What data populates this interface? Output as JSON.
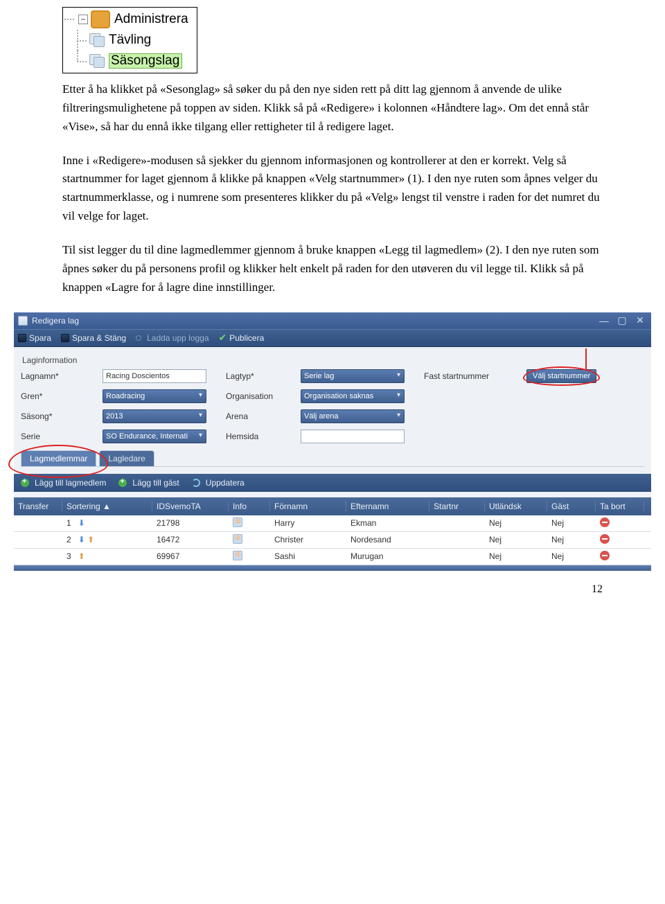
{
  "tree": {
    "root": "Administrera",
    "child1": "Tävling",
    "child2": "Säsongslag"
  },
  "para1": "Etter å ha klikket på «Sesonglag» så søker du på den nye siden rett på ditt lag gjennom å anvende de ulike filtreringsmulighetene på toppen av siden. Klikk så på «Redigere» i kolonnen «Håndtere lag». Om det ennå står «Vise», så har du ennå ikke tilgang eller rettigheter til å redigere laget.",
  "para2": "Inne i «Redigere»-modusen så sjekker du gjennom informasjonen og kontrollerer at den er korrekt. Velg så startnummer for laget gjennom å klikke på knappen «Velg startnummer» (1). I den nye ruten som åpnes velger du startnummerklasse, og i numrene som presenteres klikker du på «Velg» lengst til venstre i raden for det numret du vil velge for laget.",
  "para3": "Til sist legger du til dine lagmedlemmer gjennom å bruke knappen «Legg til lagmedlem» (2). I den nye ruten som åpnes søker du på personens profil og klikker helt enkelt på raden for den utøveren du vil legge til. Klikk så på knappen «Lagre for å lagre dine innstillinger.",
  "app": {
    "title": "Redigera lag",
    "toolbar": {
      "save": "Spara",
      "saveClose": "Spara & Stäng",
      "upload": "Ladda upp logga",
      "publish": "Publicera"
    },
    "section": "Laginformation",
    "labels": {
      "lagnamn": "Lagnamn*",
      "gren": "Gren*",
      "sasong": "Säsong*",
      "serie": "Serie",
      "lagtyp": "Lagtyp*",
      "organisation": "Organisation",
      "arena": "Arena",
      "hemsida": "Hemsida",
      "faststart": "Fast startnummer"
    },
    "values": {
      "lagnamn": "Racing Doscientos",
      "gren": "Roadracing",
      "sasong": "2013",
      "serie": "SO Endurance, Internati",
      "lagtyp": "Serie lag",
      "organisation": "Organisation saknas",
      "arena": "Välj arena",
      "startbtn": "Välj startnummer"
    },
    "tabs": {
      "members": "Lagmedlemmar",
      "leaders": "Lagledare"
    },
    "subtoolbar": {
      "addMember": "Lägg till lagmedlem",
      "addGuest": "Lägg till gäst",
      "refresh": "Uppdatera"
    },
    "columns": {
      "transfer": "Transfer",
      "sort": "Sortering ▲",
      "id": "IDSvemoTA",
      "info": "Info",
      "fname": "Förnamn",
      "lname": "Efternamn",
      "startnr": "Startnr",
      "foreign": "Utländsk",
      "guest": "Gäst",
      "remove": "Ta bort"
    },
    "rows": [
      {
        "sort": "1",
        "arrows": "down",
        "id": "21798",
        "fname": "Harry",
        "lname": "Ekman",
        "foreign": "Nej",
        "guest": "Nej"
      },
      {
        "sort": "2",
        "arrows": "both",
        "id": "16472",
        "fname": "Christer",
        "lname": "Nordesand",
        "foreign": "Nej",
        "guest": "Nej"
      },
      {
        "sort": "3",
        "arrows": "up",
        "id": "69967",
        "fname": "Sashi",
        "lname": "Murugan",
        "foreign": "Nej",
        "guest": "Nej"
      }
    ]
  },
  "pageNum": "12"
}
